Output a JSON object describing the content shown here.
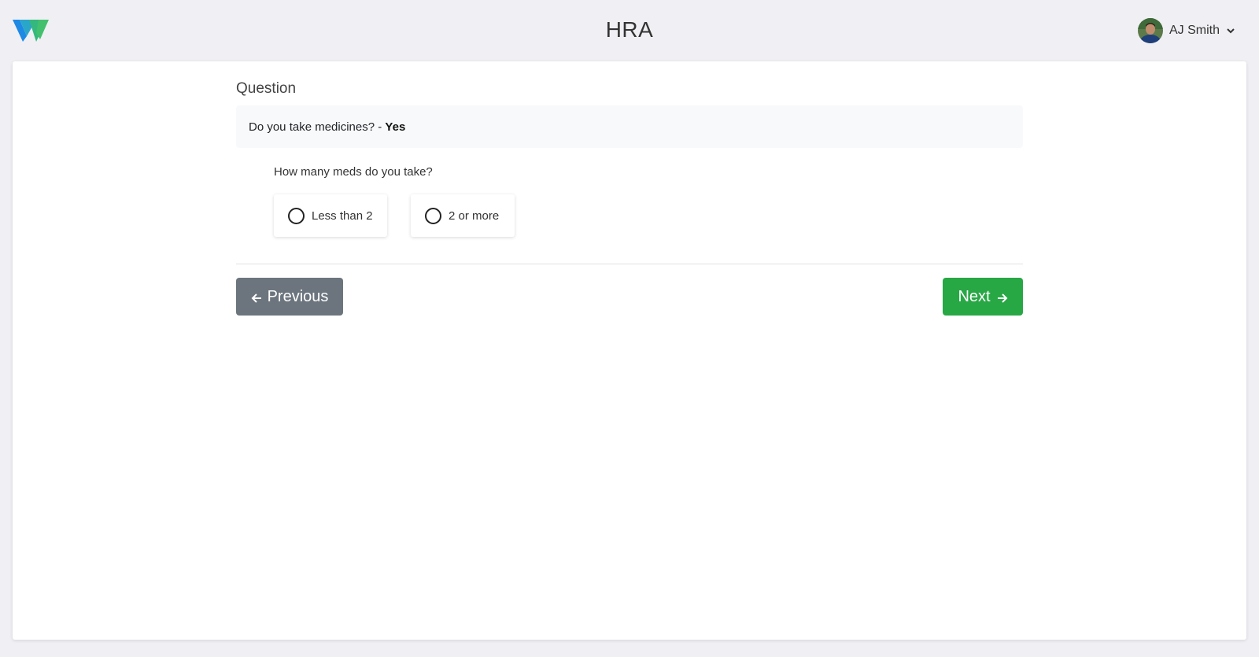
{
  "header": {
    "title": "HRA",
    "user_name": "AJ Smith"
  },
  "icons": {
    "logo": "w-logo",
    "avatar": "user-avatar",
    "user_menu": "chevron-down-icon",
    "previous": "arrow-left-icon",
    "next": "arrow-right-icon"
  },
  "question": {
    "section_label": "Question",
    "text": "Do you take medicines? - ",
    "answer": "Yes"
  },
  "sub_question": {
    "text": "How many meds do you take?",
    "options": [
      {
        "label": "Less than 2",
        "selected": false
      },
      {
        "label": "2 or more",
        "selected": false
      }
    ]
  },
  "nav": {
    "previous_label": "Previous",
    "next_label": "Next"
  },
  "colors": {
    "background": "#f0f0f4",
    "card": "#ffffff",
    "question_box": "#f8f9fa",
    "previous_button": "#6c757d",
    "next_button": "#28a745",
    "logo_blue": "#1e88e5",
    "logo_green": "#43c06e"
  }
}
